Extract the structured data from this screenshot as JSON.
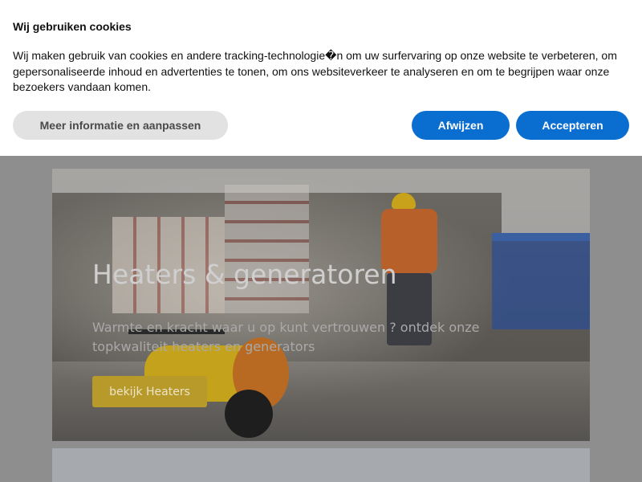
{
  "cookie_banner": {
    "title": "Wij gebruiken cookies",
    "text": "Wij maken gebruik van cookies en andere tracking-technologie�n om uw surfervaring op onze website te verbeteren, om gepersonaliseerde inhoud en advertenties te tonen, om ons websiteverkeer te analyseren en om te begrijpen waar onze bezoekers vandaan komen.",
    "more_info_label": "Meer informatie en aanpassen",
    "reject_label": "Afwijzen",
    "accept_label": "Accepteren",
    "accent_color": "#0a6ed1"
  },
  "hero": {
    "title": "Heaters & generatoren",
    "subtitle": "Warmte en kracht waar u op kunt vertrouwen ? ontdek onze topkwaliteit heaters en generators",
    "cta_label": "bekijk Heaters",
    "cta_color": "#b89a2a"
  }
}
